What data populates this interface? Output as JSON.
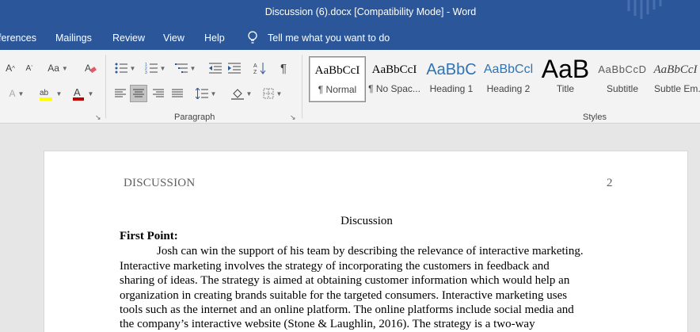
{
  "window": {
    "title": "Discussion (6).docx [Compatibility Mode]  -  Word"
  },
  "menu": {
    "tabs": [
      "ferences",
      "Mailings",
      "Review",
      "View",
      "Help"
    ],
    "tell_me": "Tell me what you want to do"
  },
  "ribbon": {
    "paragraph_group_label": "Paragraph",
    "styles_group_label": "Styles",
    "styles": [
      {
        "sample": "AaBbCcI",
        "name": "¶ Normal"
      },
      {
        "sample": "AaBbCcI",
        "name": "¶ No Spac..."
      },
      {
        "sample": "AaBbC",
        "name": "Heading 1"
      },
      {
        "sample": "AaBbCcl",
        "name": "Heading 2"
      },
      {
        "sample": "AaB",
        "name": "Title"
      },
      {
        "sample": "AaBbCcD",
        "name": "Subtitle"
      },
      {
        "sample": "AaBbCcI",
        "name": "Subtle Em..."
      }
    ],
    "colors": {
      "highlight": "#ffff00",
      "font_color": "#c00000",
      "accent": "#2b579a"
    }
  },
  "document": {
    "header_left": "DISCUSSION",
    "page_number": "2",
    "title": "Discussion",
    "first_point_label": "First Point:",
    "lines": [
      "Josh can win the support of his team by describing the relevance of interactive marketing.",
      "Interactive marketing involves the strategy of incorporating the customers in feedback and",
      "sharing of ideas. The strategy is aimed at obtaining customer information which would help an",
      "organization in creating brands suitable for the targeted consumers. Interactive marketing uses",
      "tools such as the internet and an online platform. The online platforms include social media and",
      "the company’s interactive website (Stone & Laughlin, 2016). The strategy is a two-way"
    ]
  }
}
